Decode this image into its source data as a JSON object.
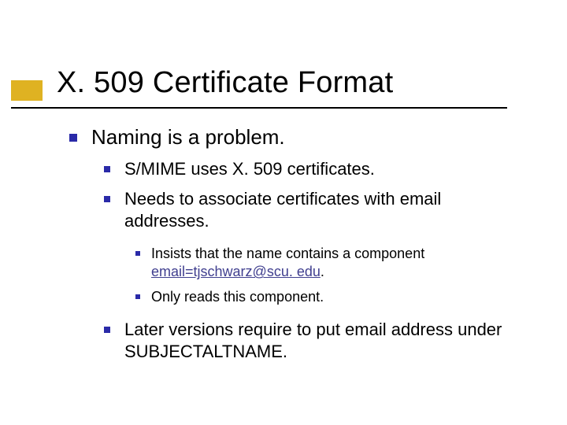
{
  "title": "X. 509 Certificate Format",
  "l1": {
    "text": "Naming is a problem."
  },
  "l2": {
    "a": "S/MIME uses X. 509 certificates.",
    "b": "Needs to associate certificates with email addresses.",
    "c": "Later versions require to put email address under SUBJECTALTNAME."
  },
  "l3": {
    "a_pre": "Insists that the name contains a component ",
    "a_link": "email=tjschwarz@scu. edu",
    "a_post": ".",
    "b": "Only reads this component."
  },
  "colors": {
    "accent": "#dfb222",
    "bullet": "#2a2aa8",
    "link": "#403f8f"
  }
}
